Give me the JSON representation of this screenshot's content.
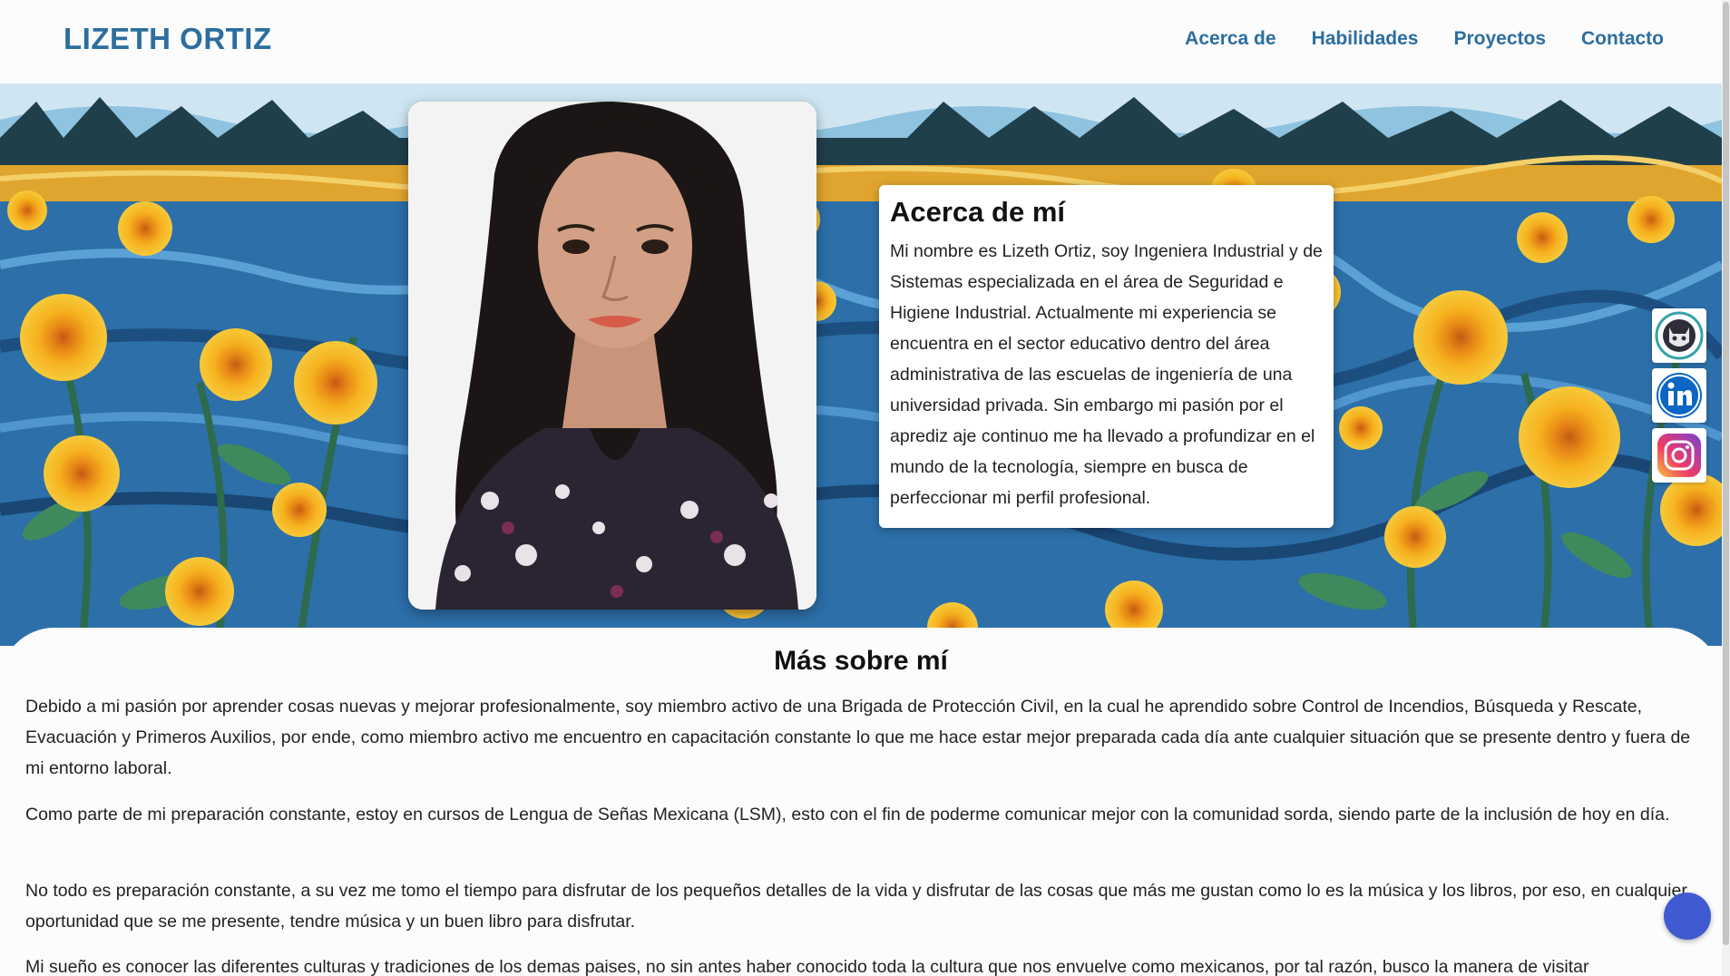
{
  "header": {
    "brand": "LIZETH ORTIZ",
    "nav": [
      "Acerca de",
      "Habilidades",
      "Proyectos",
      "Contacto"
    ]
  },
  "about": {
    "title": "Acerca de mí",
    "text": "Mi nombre es Lizeth Ortiz, soy Ingeniera Industrial y de Sistemas especializada en el área de Seguridad e Higiene Industrial. Actualmente mi experiencia se encuentra en el sector educativo dentro del área administrativa de las escuelas de ingeniería de una universidad privada. Sin embargo mi pasión por el aprediz aje continuo me ha llevado a profundizar en el mundo de la tecnología, siempre en busca de perfeccionar mi perfil profesional."
  },
  "social": {
    "icons": [
      "github-icon",
      "linkedin-icon",
      "instagram-icon"
    ]
  },
  "more": {
    "title": "Más sobre mí",
    "paragraphs": [
      "Debido a mi pasión por aprender cosas nuevas y mejorar profesionalmente, soy miembro activo de una Brigada de Protección Civil, en la cual he aprendido sobre Control de Incendios, Búsqueda y Rescate, Evacuación y Primeros Auxilios, por ende, como miembro activo me encuentro en capacitación constante lo que me hace estar mejor preparada cada día ante cualquier situación que se presente dentro y fuera de mi entorno laboral.",
      "Como parte de mi preparación constante, estoy en cursos de Lengua de Señas Mexicana (LSM), esto con el fin de poderme comunicar mejor con la comunidad sorda, siendo parte de la inclusión de hoy en día.",
      "No todo es preparación constante, a su vez me tomo el tiempo para disfrutar de los pequeños detalles de la vida y disfrutar de las cosas que más me gustan como lo es la música y los libros, por eso, en cualquier oportunidad que se me presente, tendre música y un buen libro para disfrutar.",
      "Mi sueño es conocer las diferentes culturas y tradiciones de los demas paises, no sin antes haber conocido toda la cultura que nos envuelve como mexicanos, por tal razón, busco la manera de visitar"
    ]
  },
  "colors": {
    "accent": "#2d6e9e",
    "chat": "#3f5bd1"
  }
}
